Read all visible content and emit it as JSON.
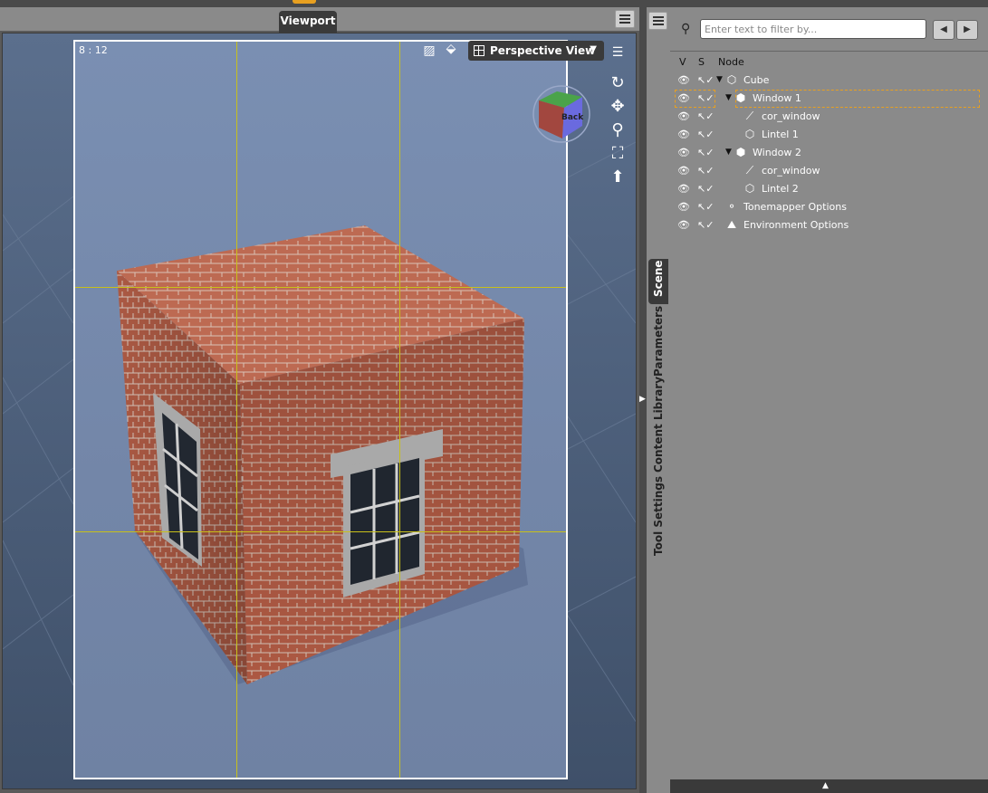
{
  "viewport": {
    "tab_label": "Viewport",
    "timecode": "8 : 12",
    "view_label": "Perspective View",
    "view_dropdown": "▼",
    "cube_label": "Back"
  },
  "side_tabs": [
    "Scene",
    "Parameters",
    "Content Library",
    "Tool Settings"
  ],
  "scene": {
    "filter_placeholder": "Enter text to filter by...",
    "columns": {
      "v": "V",
      "s": "S",
      "node": "Node"
    },
    "rows": [
      {
        "label": "Cube",
        "icon": "cube-icon",
        "expanded": "▼"
      },
      {
        "label": "Window 1",
        "icon": "group-icon",
        "expanded": "▼"
      },
      {
        "label": "cor_window",
        "icon": "bone-icon"
      },
      {
        "label": "Lintel 1",
        "icon": "cube-icon"
      },
      {
        "label": "Window 2",
        "icon": "group-icon",
        "expanded": "▼"
      },
      {
        "label": "cor_window",
        "icon": "bone-icon"
      },
      {
        "label": "Lintel 2",
        "icon": "cube-icon"
      },
      {
        "label": "Tonemapper Options",
        "icon": "tonemapper-icon"
      },
      {
        "label": "Environment Options",
        "icon": "environment-icon"
      }
    ]
  },
  "colors": {
    "highlight": "#e8a020",
    "background": "#7b8fb0",
    "brick": "#b5624a",
    "guide": "#c8c01a"
  }
}
